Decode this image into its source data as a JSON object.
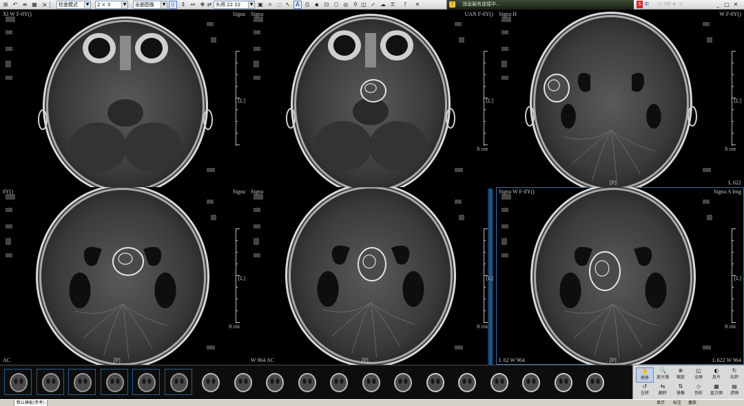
{
  "toolbar": {
    "mode_select": "检查模式",
    "layout_select": "2 × 3",
    "image_select": "全部图像",
    "series_select": "头颅 22 22",
    "status_message": "消息服务连接中..."
  },
  "viewports": [
    {
      "top_left": "XI        W F-8Y()",
      "top_right": "Signa",
      "bottom_left": "",
      "bottom_right": "",
      "orient_right": "[L]",
      "orient_bottom": "",
      "scale": ""
    },
    {
      "top_left": "Signa",
      "top_right": "UAN F-8Y()",
      "bottom_left": "",
      "bottom_right": "",
      "orient_right": "[L]",
      "orient_bottom": "",
      "scale": "8 cm"
    },
    {
      "top_left": "Signa H",
      "top_right": "W F-8Y()",
      "bottom_left": "",
      "bottom_right": "L 622",
      "orient_right": "[L]",
      "orient_bottom": "[P]",
      "scale": "8 cm"
    },
    {
      "top_left": "8Y()",
      "top_right": "Signa",
      "bottom_left": "AC",
      "bottom_right": "",
      "orient_right": "[L]",
      "orient_bottom": "[P]",
      "scale": "8 cm"
    },
    {
      "top_left": "Signa",
      "top_right": "",
      "bottom_left": "W 964  AC",
      "bottom_right": "",
      "orient_right": "[L]",
      "orient_bottom": "[P]",
      "scale": "8 cm"
    },
    {
      "top_left": "Signa  W F-8Y()",
      "top_right": "Signa  A  Img",
      "bottom_left": "L 62  W 964",
      "bottom_right": "L 622  W 964",
      "orient_right": "[L]",
      "orient_bottom": "[P]",
      "scale": "8 cm"
    }
  ],
  "thumbnails_count": 19,
  "tools": [
    {
      "icon": "✋",
      "label": "拖移"
    },
    {
      "icon": "🔍",
      "label": "放大镜"
    },
    {
      "icon": "⊕",
      "label": "缩放"
    },
    {
      "icon": "◱",
      "label": "全屏"
    },
    {
      "icon": "◐",
      "label": "反片"
    },
    {
      "icon": "↻",
      "label": "右转"
    },
    {
      "icon": "↺",
      "label": "左转"
    },
    {
      "icon": "⇆",
      "label": "翻转"
    },
    {
      "icon": "⇅",
      "label": "镜像"
    },
    {
      "icon": "◇",
      "label": "伪彩"
    },
    {
      "icon": "▦",
      "label": "直方图"
    },
    {
      "icon": "▤",
      "label": "滤镜"
    }
  ],
  "bottom_tabs": [
    {
      "label": "默认模板(参考)"
    },
    {
      "label": "显示"
    },
    {
      "label": "标注"
    },
    {
      "label": "播放"
    }
  ],
  "colors": {
    "active_viewport": "#3f6fa6",
    "toolbar_bg": "#e4e4e4",
    "status_bg": "#2a3424"
  }
}
